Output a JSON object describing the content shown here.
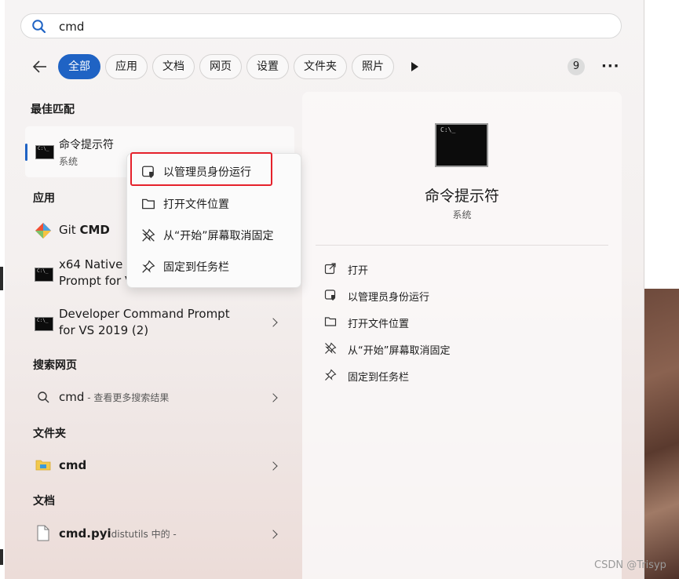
{
  "search": {
    "value": "cmd"
  },
  "tabs": [
    "全部",
    "应用",
    "文档",
    "网页",
    "设置",
    "文件夹",
    "照片"
  ],
  "result_count": "9",
  "sections": {
    "best": "最佳匹配",
    "apps": "应用",
    "web": "搜索网页",
    "folders": "文件夹",
    "docs": "文档"
  },
  "best_match": {
    "title": "命令提示符",
    "subtitle": "系统"
  },
  "apps": {
    "git_prefix": "Git ",
    "git_bold": "CMD",
    "x64_line1": "x64 Native T",
    "x64_line2": "Prompt for V",
    "dev_line1": "Developer Command Prompt",
    "dev_line2": "for VS 2019 (2)"
  },
  "web": {
    "query": "cmd",
    "hint": " - 查看更多搜索结果"
  },
  "folder": {
    "name": "cmd"
  },
  "doc": {
    "name": "cmd.pyi",
    "hint": "distutils 中的 -"
  },
  "context_menu": [
    "以管理员身份运行",
    "打开文件位置",
    "从“开始”屏幕取消固定",
    "固定到任务栏"
  ],
  "right_panel": {
    "title": "命令提示符",
    "subtitle": "系统",
    "actions": [
      "打开",
      "以管理员身份运行",
      "打开文件位置",
      "从“开始”屏幕取消固定",
      "固定到任务栏"
    ]
  },
  "watermark": "CSDN @Trisyp",
  "colors": {
    "accent": "#1f63c4",
    "highlight": "#e5212b"
  }
}
